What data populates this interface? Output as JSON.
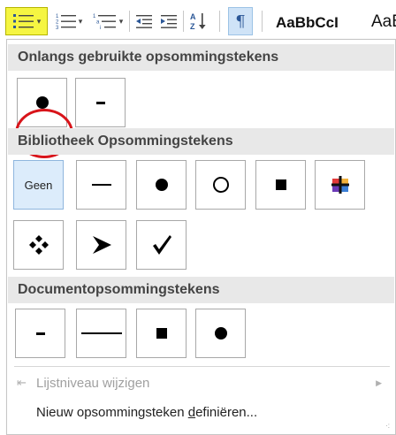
{
  "ribbon": {
    "bullets_icon": "bullet-list-icon",
    "numbering_icon": "numbered-list-icon",
    "multilevel_icon": "multilevel-list-icon",
    "decrease_indent_icon": "decrease-indent-icon",
    "increase_indent_icon": "increase-indent-icon",
    "sort_icon": "sort-az-icon",
    "pilcrow_symbol": "¶",
    "style_preview_1": "AaBbCcI",
    "style_preview_2": "AaB",
    "bullets_highlight_color": "#f5f542",
    "pilcrow_active_color": "#cfe3f7"
  },
  "gallery": {
    "recent": {
      "heading": "Onlangs gebruikte opsommingstekens",
      "items": [
        "bullet-dot",
        "bullet-dash"
      ]
    },
    "library": {
      "heading": "Bibliotheek Opsommingstekens",
      "items": [
        "Geen",
        "bullet-line",
        "bullet-dot",
        "bullet-circle",
        "bullet-square",
        "bullet-cross-colored",
        "bullet-diamond-dots",
        "bullet-arrowhead",
        "bullet-checkmark"
      ],
      "none_label": "Geen"
    },
    "document": {
      "heading": "Documentopsommingstekens",
      "items": [
        "bullet-dash",
        "bullet-long-line",
        "bullet-square",
        "bullet-dot"
      ]
    },
    "annotation_color": "#d8141a"
  },
  "menu": {
    "change_level": {
      "label": "Lijstniveau wijzigen",
      "enabled": false,
      "icon": "list-level-icon"
    },
    "define_new": {
      "label_prefix": "Nieuw opsommingsteken ",
      "label_accel": "d",
      "label_suffix": "efiniëren..."
    }
  }
}
